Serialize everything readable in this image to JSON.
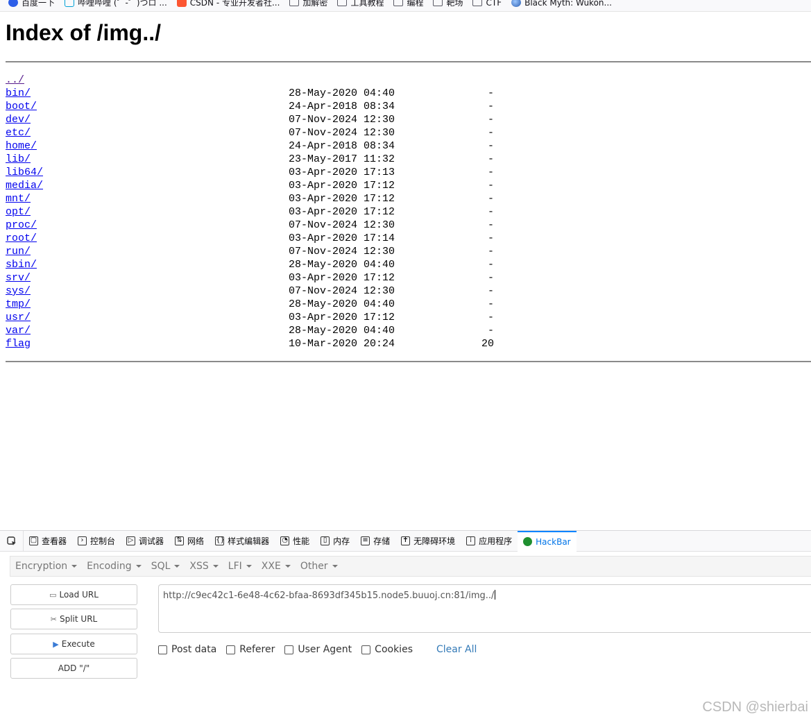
{
  "bookmarks": [
    {
      "label": "百度一下",
      "icon": "baidu-icon"
    },
    {
      "label": "哔哩哔哩 (゜-゜)つロ ...",
      "icon": "bilibili-icon"
    },
    {
      "label": "CSDN - 专业开发者社...",
      "icon": "csdn-icon"
    },
    {
      "label": "加解密",
      "icon": "folder-icon"
    },
    {
      "label": "工具教程",
      "icon": "folder-icon"
    },
    {
      "label": "编程",
      "icon": "folder-icon"
    },
    {
      "label": "靶场",
      "icon": "folder-icon"
    },
    {
      "label": "CTF",
      "icon": "folder-icon"
    },
    {
      "label": "Black Myth: Wukon...",
      "icon": "globe-icon"
    }
  ],
  "page": {
    "title": "Index of /img../",
    "entries": [
      {
        "name": "../",
        "date": "",
        "size": ""
      },
      {
        "name": "bin/",
        "date": "28-May-2020 04:40",
        "size": "-"
      },
      {
        "name": "boot/",
        "date": "24-Apr-2018 08:34",
        "size": "-"
      },
      {
        "name": "dev/",
        "date": "07-Nov-2024 12:30",
        "size": "-"
      },
      {
        "name": "etc/",
        "date": "07-Nov-2024 12:30",
        "size": "-"
      },
      {
        "name": "home/",
        "date": "24-Apr-2018 08:34",
        "size": "-"
      },
      {
        "name": "lib/",
        "date": "23-May-2017 11:32",
        "size": "-"
      },
      {
        "name": "lib64/",
        "date": "03-Apr-2020 17:13",
        "size": "-"
      },
      {
        "name": "media/",
        "date": "03-Apr-2020 17:12",
        "size": "-"
      },
      {
        "name": "mnt/",
        "date": "03-Apr-2020 17:12",
        "size": "-"
      },
      {
        "name": "opt/",
        "date": "03-Apr-2020 17:12",
        "size": "-"
      },
      {
        "name": "proc/",
        "date": "07-Nov-2024 12:30",
        "size": "-"
      },
      {
        "name": "root/",
        "date": "03-Apr-2020 17:14",
        "size": "-"
      },
      {
        "name": "run/",
        "date": "07-Nov-2024 12:30",
        "size": "-"
      },
      {
        "name": "sbin/",
        "date": "28-May-2020 04:40",
        "size": "-"
      },
      {
        "name": "srv/",
        "date": "03-Apr-2020 17:12",
        "size": "-"
      },
      {
        "name": "sys/",
        "date": "07-Nov-2024 12:30",
        "size": "-"
      },
      {
        "name": "tmp/",
        "date": "28-May-2020 04:40",
        "size": "-"
      },
      {
        "name": "usr/",
        "date": "03-Apr-2020 17:12",
        "size": "-"
      },
      {
        "name": "var/",
        "date": "28-May-2020 04:40",
        "size": "-"
      },
      {
        "name": "flag",
        "date": "10-Mar-2020 20:24",
        "size": "20"
      }
    ]
  },
  "devtools": {
    "tabs": [
      {
        "label": "查看器",
        "icon": "inspector-icon",
        "glyph": "▢"
      },
      {
        "label": "控制台",
        "icon": "console-icon",
        "glyph": "›"
      },
      {
        "label": "调试器",
        "icon": "debugger-icon",
        "glyph": "▷"
      },
      {
        "label": "网络",
        "icon": "network-icon",
        "glyph": "⇅"
      },
      {
        "label": "样式编辑器",
        "icon": "style-editor-icon",
        "glyph": "{}"
      },
      {
        "label": "性能",
        "icon": "performance-icon",
        "glyph": "◔"
      },
      {
        "label": "内存",
        "icon": "memory-icon",
        "glyph": "▯"
      },
      {
        "label": "存储",
        "icon": "storage-icon",
        "glyph": "≡"
      },
      {
        "label": "无障碍环境",
        "icon": "accessibility-icon",
        "glyph": "✝"
      },
      {
        "label": "应用程序",
        "icon": "application-icon",
        "glyph": "⁞"
      },
      {
        "label": "HackBar",
        "icon": "hackbar-icon",
        "glyph": ""
      }
    ],
    "active_tab": "HackBar"
  },
  "hackbar": {
    "menu": [
      "Encryption",
      "Encoding",
      "SQL",
      "XSS",
      "LFI",
      "XXE",
      "Other"
    ],
    "buttons": {
      "load_url": "Load URL",
      "split_url": "Split URL",
      "execute": "Execute",
      "add_slash": "ADD \"/\""
    },
    "url": "http://c9ec42c1-6e48-4c62-bfaa-8693df345b15.node5.buuoj.cn:81/img../",
    "options": [
      "Post data",
      "Referer",
      "User Agent",
      "Cookies"
    ],
    "clear_all": "Clear All"
  },
  "watermark": "CSDN @shierbai",
  "colors": {
    "link": "#0000ee",
    "visited_link": "#551a8b",
    "active_tab": "#0074e8",
    "hackbar_link": "#337ab7"
  }
}
